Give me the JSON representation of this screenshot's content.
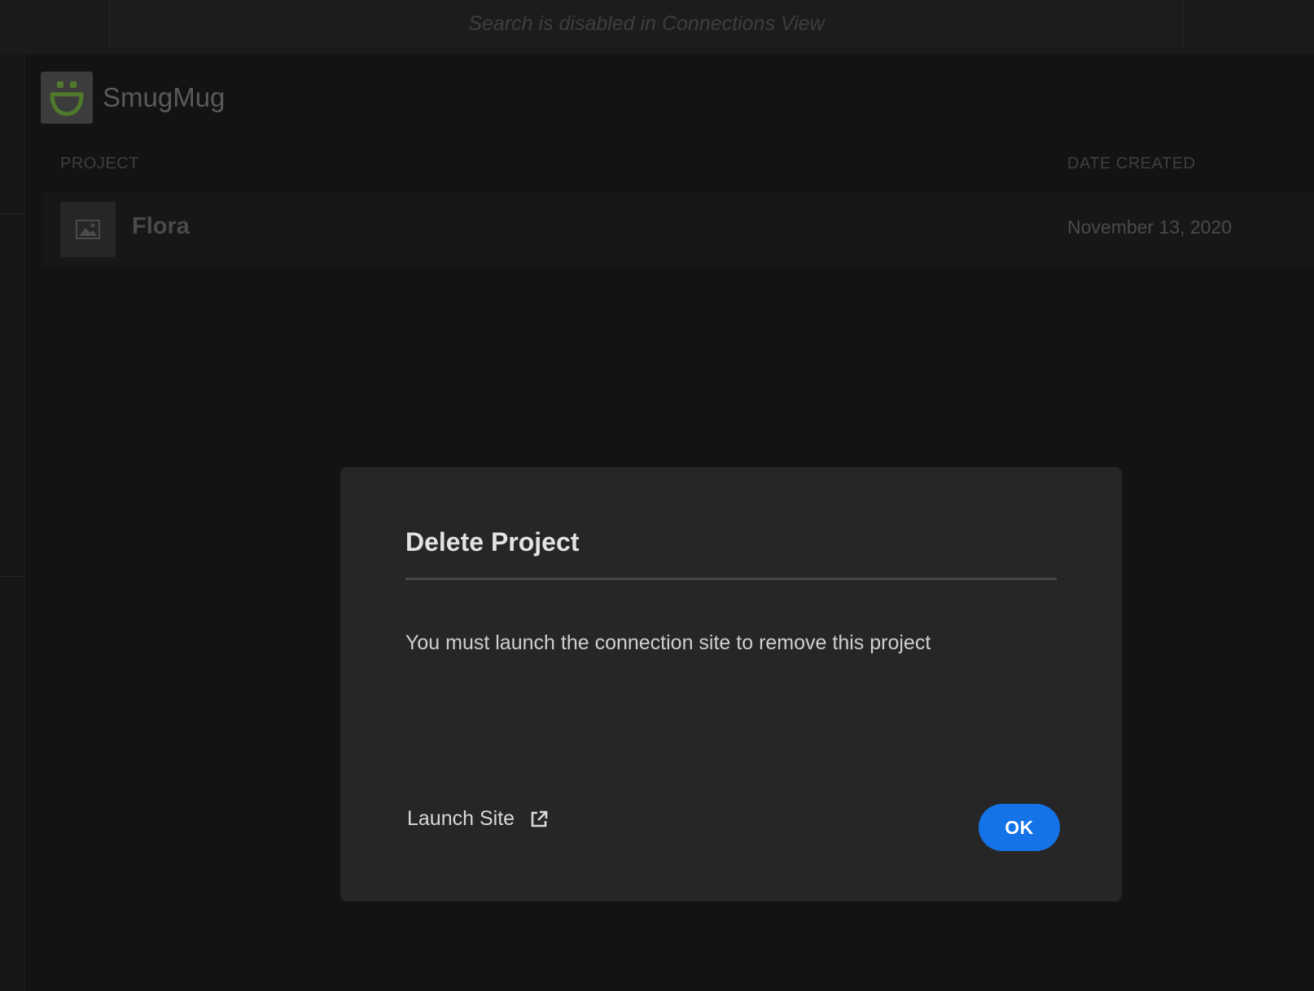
{
  "search": {
    "placeholder": "Search is disabled in Connections View"
  },
  "service": {
    "name": "SmugMug",
    "logo_icon": "smugmug-logo",
    "logo_color": "#5a8a2e"
  },
  "table": {
    "columns": [
      "PROJECT",
      "DATE CREATED"
    ],
    "rows": [
      {
        "thumbnail_icon": "image-icon",
        "name": "Flora",
        "date_created": "November 13, 2020"
      }
    ]
  },
  "dialog": {
    "title": "Delete Project",
    "message": "You must launch the connection site to remove this project",
    "launch_label": "Launch Site",
    "launch_icon": "external-link-icon",
    "ok_label": "OK",
    "ok_color": "#1473e6"
  }
}
